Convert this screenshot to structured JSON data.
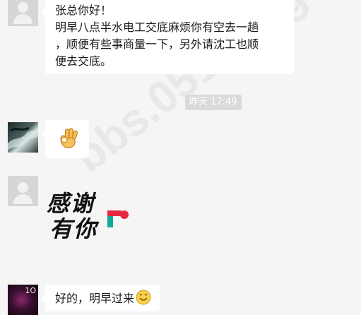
{
  "watermark": "bbs.0513.org",
  "messages": [
    {
      "id": "msg1",
      "sender": "other",
      "avatar": "default-avatar",
      "lines": [
        "张总你好！",
        "明早八点半水电工交底麻烦你有空去一趟",
        "，顺便有些事商量一下，另外请沈工也顺",
        "便去交底。"
      ]
    },
    {
      "id": "time1",
      "timestamp": "昨天 17:49"
    },
    {
      "id": "msg2",
      "sender": "other",
      "avatar": "dragon-photo-avatar",
      "emoji": "ok-hand-emoji"
    },
    {
      "id": "msg3",
      "sender": "other",
      "avatar": "default-avatar",
      "sticker": {
        "line1": "感谢",
        "line2": "有你"
      }
    },
    {
      "id": "msg4",
      "sender": "other",
      "avatar": "dark-photo-avatar",
      "avatar_tag": "1O",
      "text": "好的，明早过来",
      "emoji": "smiling-face-emoji"
    }
  ],
  "colors": {
    "background": "#f5f5f5",
    "bubble": "#ffffff",
    "time_pill": "#dadada",
    "sticker_red": "#e8283f",
    "sticker_teal": "#14a89b"
  }
}
